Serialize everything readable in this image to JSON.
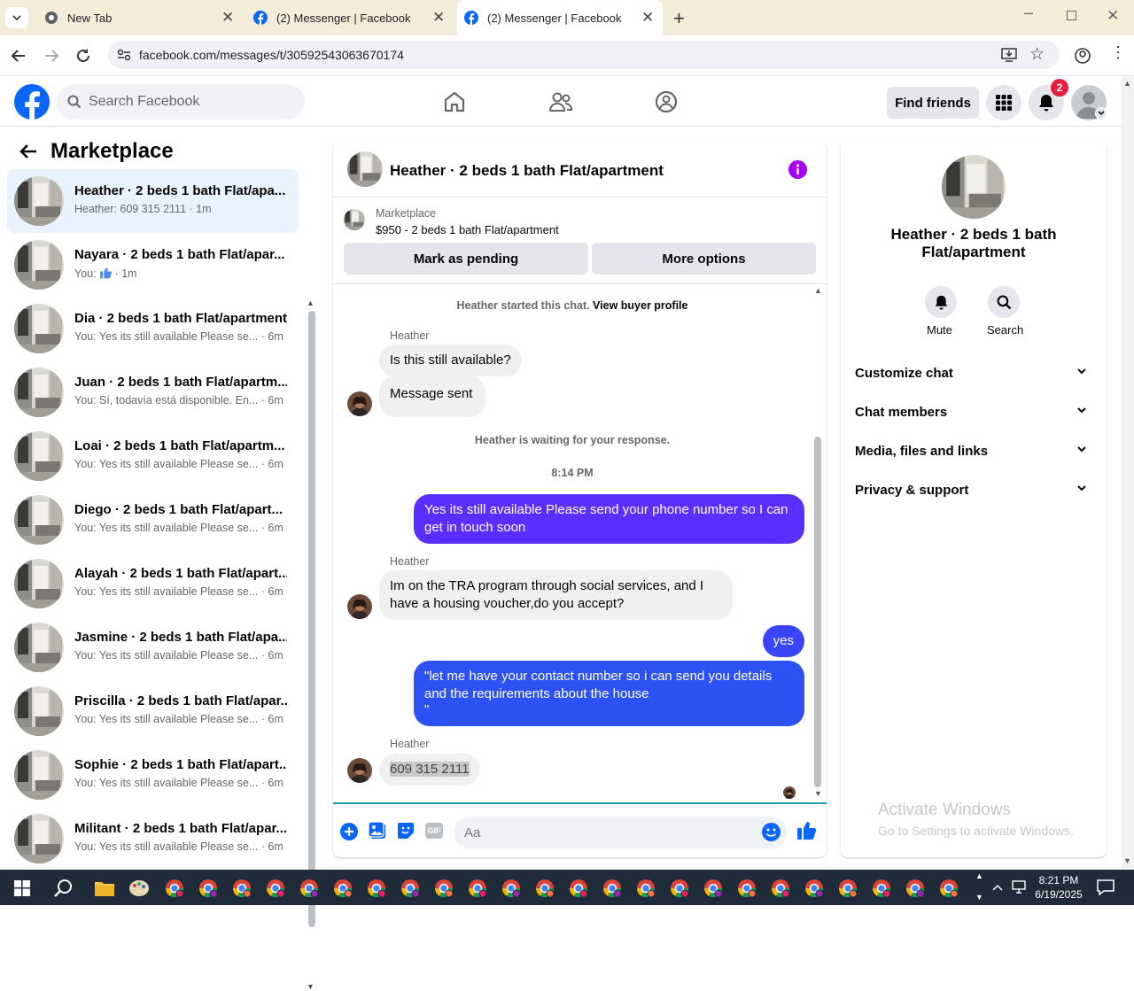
{
  "browser": {
    "tabs": [
      {
        "title": "New Tab",
        "icon": "chrome-icon"
      },
      {
        "title": "(2) Messenger | Facebook",
        "icon": "facebook-icon"
      },
      {
        "title": "(2) Messenger | Facebook",
        "icon": "facebook-icon",
        "active": true
      }
    ],
    "url": "facebook.com/messages/t/30592543063670174"
  },
  "fb_header": {
    "search_placeholder": "Search Facebook",
    "find_friends": "Find friends",
    "notification_count": "2"
  },
  "sidebar": {
    "title": "Marketplace",
    "conversations": [
      {
        "name": "Heather · 2 beds 1 bath Flat/apa...",
        "preview": "Heather: 609 315 2111 · 1m",
        "selected": true
      },
      {
        "name": "Nayara · 2 beds 1 bath Flat/apar...",
        "preview_prefix": "You:",
        "preview": "· 1m"
      },
      {
        "name": "Dia · 2 beds 1 bath Flat/apartment",
        "preview": "You: Yes its still available Please se... · 6m"
      },
      {
        "name": "Juan · 2 beds 1 bath Flat/apartm...",
        "preview": "You: Sí, todavía está disponible. En... · 6m"
      },
      {
        "name": "Loai · 2 beds 1 bath Flat/apartm...",
        "preview": "You: Yes its still available Please se... · 6m"
      },
      {
        "name": "Diego · 2 beds 1 bath Flat/apart...",
        "preview": "You: Yes its still available Please se... · 6m"
      },
      {
        "name": "Alayah · 2 beds 1 bath Flat/apart...",
        "preview": "You: Yes its still available Please se... · 6m"
      },
      {
        "name": "Jasmine · 2 beds 1 bath Flat/apa...",
        "preview": "You: Yes its still available Please se... · 6m"
      },
      {
        "name": "Priscilla · 2 beds 1 bath Flat/apar...",
        "preview": "You: Yes its still available Please se... · 6m"
      },
      {
        "name": "Sophie · 2 beds 1 bath Flat/apart...",
        "preview": "You: Yes its still available Please se... · 6m"
      },
      {
        "name": "Militant · 2 beds 1 bath Flat/apar...",
        "preview": "You: Yes its still available Please se... · 6m"
      }
    ]
  },
  "chat": {
    "title": "Heather · 2 beds 1 bath Flat/apartment",
    "listing_label": "Marketplace",
    "listing_desc": "$950 - 2 beds 1 bath Flat/apartment",
    "mark_pending": "Mark as pending",
    "more_options": "More options",
    "started_text": "Heather started this chat.",
    "view_profile": "View buyer profile",
    "sender_name": "Heather",
    "msg_in_1": "Is this still available?",
    "msg_in_2": "Message sent",
    "waiting_text": "Heather is waiting for your response.",
    "time": "8:14 PM",
    "msg_out_1_line1": "Yes its still available Please send your phone number so I can",
    "msg_out_1_line2": "get in touch soon",
    "msg_in_3_line1": "Im on the TRA program through social services, and I",
    "msg_in_3_line2": "have a housing voucher,do you accept?",
    "msg_out_2": "yes",
    "msg_out_3_line1": "\"let me have your contact number so i can send you details",
    "msg_out_3_line2": "and the requirements about the house",
    "msg_out_3_line3": "\"",
    "msg_in_4": "609 315 2111",
    "input_placeholder": "Aa",
    "colors": {
      "accent": "#0866ff",
      "purple_bubble": "#5a2eff",
      "blue_bubble": "#2c52f5",
      "info": "#a400f5"
    }
  },
  "right_panel": {
    "name_line1": "Heather · 2 beds 1 bath",
    "name_line2": "Flat/apartment",
    "mute": "Mute",
    "search": "Search",
    "sections": [
      "Customize chat",
      "Chat members",
      "Media, files and links",
      "Privacy & support"
    ],
    "watermark_title": "Activate Windows",
    "watermark_sub": "Go to Settings to activate Windows."
  },
  "taskbar": {
    "time": "8:21 PM",
    "date": "6/19/2025"
  }
}
